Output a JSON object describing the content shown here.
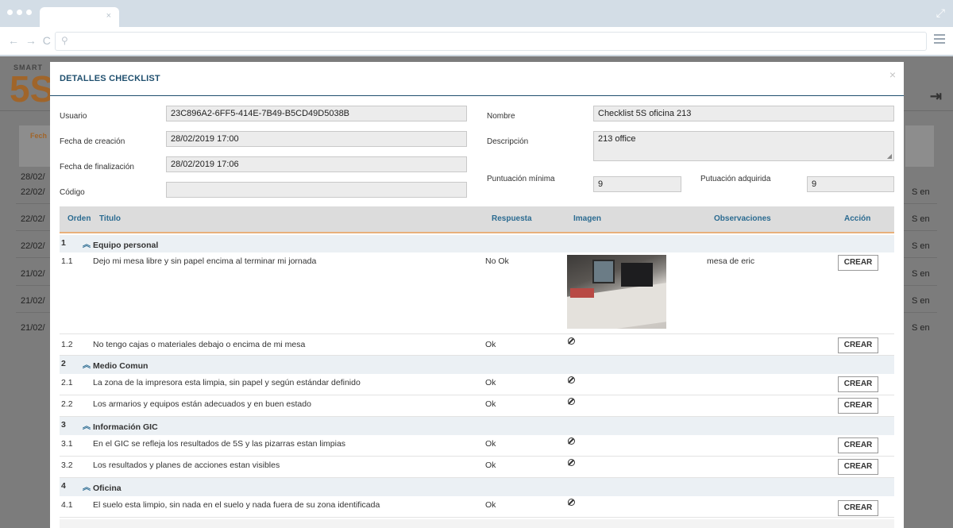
{
  "browser": {
    "tab_close": "×",
    "nav": "← → C",
    "search_glyph": "⚲",
    "expand_glyph": "⤢"
  },
  "background": {
    "logo_small": "SMART",
    "logo_big": "5S",
    "dates": [
      "28/02/",
      "22/02/",
      "22/02/",
      "22/02/",
      "21/02/",
      "21/02/",
      "21/02/"
    ],
    "right_texts": [
      "S en",
      "S en",
      "S en",
      "S en",
      "S en",
      "S en"
    ],
    "card_label": "Fech"
  },
  "modal": {
    "title": "DETALLES CHECKLIST",
    "close": "×",
    "fields": {
      "usuario_label": "Usuario",
      "usuario_value": "23C896A2-6FF5-414E-7B49-B5CD49D5038B",
      "fecha_creacion_label": "Fecha de creación",
      "fecha_creacion_value": "28/02/2019 17:00",
      "fecha_finalizacion_label": "Fecha de finalización",
      "fecha_finalizacion_value": "28/02/2019 17:06",
      "codigo_label": "Código",
      "codigo_value": "",
      "nombre_label": "Nombre",
      "nombre_value": "Checklist 5S oficina 213",
      "descripcion_label": "Descripción",
      "descripcion_value": "213 office",
      "puntuacion_minima_label": "Puntuación mínima",
      "puntuacion_minima_value": "9",
      "puntuacion_adquirida_label": "Putuación adquirida",
      "puntuacion_adquirida_value": "9"
    },
    "table": {
      "headers": {
        "orden": "Orden",
        "titulo": "Titulo",
        "respuesta": "Respuesta",
        "imagen": "Imagen",
        "observaciones": "Observaciones",
        "accion": "Acción"
      },
      "sections": [
        {
          "num": "1",
          "name": "Equipo personal",
          "items": [
            {
              "num": "1.1",
              "title": "Dejo mi mesa libre y sin papel encima al terminar mi jornada",
              "answer": "No Ok",
              "image": true,
              "obs": "mesa de eric",
              "action": "CREAR"
            },
            {
              "num": "1.2",
              "title": "No tengo cajas o materiales debajo o encima de mi mesa",
              "answer": "Ok",
              "image": false,
              "obs": "",
              "action": "CREAR"
            }
          ]
        },
        {
          "num": "2",
          "name": "Medio Comun",
          "items": [
            {
              "num": "2.1",
              "title": "La zona de la impresora esta limpia, sin papel y según estándar definido",
              "answer": "Ok",
              "image": false,
              "obs": "",
              "action": "CREAR"
            },
            {
              "num": "2.2",
              "title": "Los armarios y equipos están adecuados y en buen estado",
              "answer": "Ok",
              "image": false,
              "obs": "",
              "action": "CREAR"
            }
          ]
        },
        {
          "num": "3",
          "name": "Información GIC",
          "items": [
            {
              "num": "3.1",
              "title": "En el GIC se refleja los resultados de 5S y las pizarras estan limpias",
              "answer": "Ok",
              "image": false,
              "obs": "",
              "action": "CREAR"
            },
            {
              "num": "3.2",
              "title": "Los resultados y planes de acciones estan visibles",
              "answer": "Ok",
              "image": false,
              "obs": "",
              "action": "CREAR"
            }
          ]
        },
        {
          "num": "4",
          "name": "Oficina",
          "items": [
            {
              "num": "4.1",
              "title": "El suelo esta limpio, sin nada en el suelo y nada fuera de su zona identificada",
              "answer": "Ok",
              "image": false,
              "obs": "",
              "action": "CREAR"
            }
          ]
        }
      ],
      "chevron": "︽"
    }
  }
}
